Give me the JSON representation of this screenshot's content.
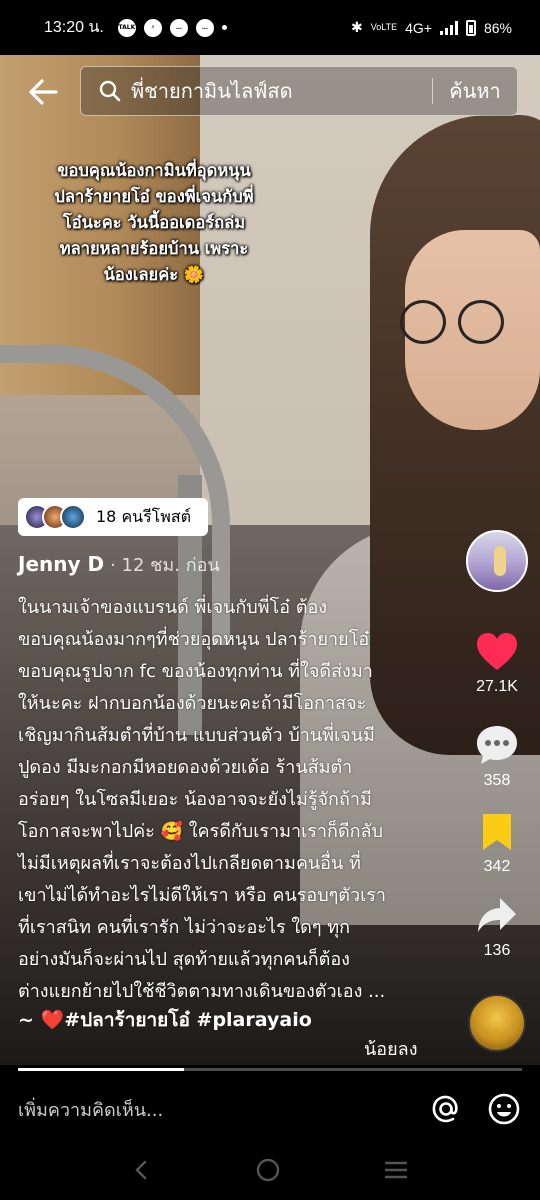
{
  "status_bar": {
    "time": "13:20 น.",
    "network": "4G+",
    "volte": "VoLTE",
    "battery": "86%"
  },
  "search": {
    "query": "พี่ชายกามินไลฟ์สด",
    "button_label": "ค้นหา"
  },
  "video_overlay_lines": [
    "ขอบคุณน้องกามินที่อุดหนุน",
    "ปลาร้ายายโอ๋ ของพี่เจนกับพี่",
    "โอ๋นะคะ วันนี้ออเดอร์ถล่ม",
    "ทลายหลายร้อยบ้าน เพราะ",
    "น้องเลยค่ะ 🌼"
  ],
  "repost": {
    "label": "18 คนรีโพสต์"
  },
  "author": {
    "name": "Jenny D",
    "time_ago": "· 12 ชม. ก่อน"
  },
  "caption_lines": [
    "ในนามเจ้าของแบรนด์ พี่เจนกับพี่โอ๋ ต้อง",
    "ขอบคุณน้องมากๆที่ช่วยอุดหนุน ปลาร้ายายโอ๋",
    "ขอบคุณรูปจาก fc ของน้องทุกท่าน ที่ใจดีส่งมา",
    "ให้นะคะ  ฝากบอกน้องด้วยนะคะถ้ามีโอกาสจะ",
    "เชิญมากินส้มตำที่บ้าน แบบส่วนตัว บ้านพี่เจนมี",
    "ปูดอง มีมะกอกมีหอยดองด้วยเด้อ ร้านส้มตำ",
    "อร่อยๆ ในโซลมีเยอะ น้องอาจจะยังไม่รู้จักถ้ามี",
    "โอกาสจะพาไปค่ะ 🥰 ใครดีกับเรามาเราก็ดีกลับ",
    "ไม่มีเหตุผลที่เราจะต้องไปเกลียดตามคนอื่น ที่",
    "เขาไม่ได้ทำอะไรไม่ดีให้เรา หรือ คนรอบๆตัวเรา",
    "ที่เราสนิท คนที่เรารัก ไม่ว่าจะอะไร ใดๆ ทุก",
    "อย่างมันก็จะผ่านไป สุดท้ายแล้วทุกคนก็ต้อง",
    "ต่างแยกย้ายไปใช้ชีวิตตามทางเดินของตัวเอง ..."
  ],
  "hashtags": "~ ❤️#ปลาร้ายายโอ๋  #plarayaio",
  "see_less": "น้อยลง",
  "stats": {
    "likes": "27.1K",
    "comments": "358",
    "saves": "342",
    "shares": "136"
  },
  "progress_fraction": 0.33,
  "comment_placeholder": "เพิ่มความคิดเห็น...",
  "colors": {
    "like": "#fe2c55",
    "save": "#facc15",
    "background": "#000000"
  },
  "icons": [
    "back-arrow-icon",
    "search-icon",
    "heart-icon",
    "comment-icon",
    "bookmark-icon",
    "share-icon",
    "at-icon",
    "emoji-icon",
    "nav-back-icon",
    "nav-home-icon",
    "nav-recents-icon"
  ]
}
